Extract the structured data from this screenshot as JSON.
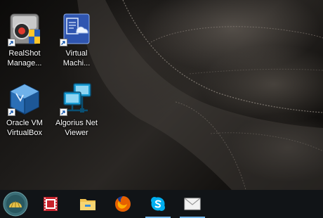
{
  "desktop": {
    "icons": [
      {
        "label": "RealShot Manage...",
        "icon": "realshot-manager-icon"
      },
      {
        "label": "Virtual Machi...",
        "icon": "virtual-machine-icon"
      },
      {
        "label": "Oracle VM VirtualBox",
        "icon": "virtualbox-icon"
      },
      {
        "label": "Algorius Net Viewer",
        "icon": "network-viewer-icon"
      }
    ]
  },
  "taskbar": {
    "items": [
      {
        "icon": "start-shell-icon"
      },
      {
        "icon": "film-app-icon"
      },
      {
        "icon": "file-explorer-icon"
      },
      {
        "icon": "firefox-icon"
      },
      {
        "icon": "skype-icon",
        "active": true
      },
      {
        "icon": "mail-icon",
        "active": true
      }
    ]
  },
  "colors": {
    "taskbar_bg": "#111417",
    "active_indicator": "#76b9ed",
    "label_text": "#ffffff"
  }
}
